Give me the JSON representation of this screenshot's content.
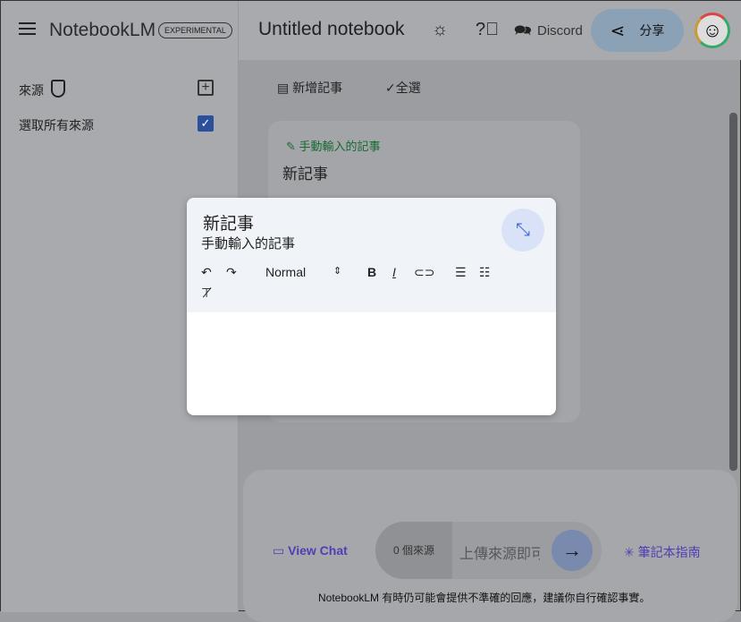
{
  "header": {
    "brand": "NotebookLM",
    "badge": "EXPERIMENTAL",
    "title": "Untitled notebook",
    "discord": "Discord",
    "share": "分享"
  },
  "sidebar": {
    "sources_label": "來源",
    "select_all": "選取所有來源"
  },
  "toolbar": {
    "add_note": "新增記事",
    "select_all": "全選"
  },
  "note_card": {
    "label": "手動輸入的記事",
    "title": "新記事"
  },
  "editor": {
    "title": "新記事",
    "subtitle": "手動輸入的記事",
    "format": "Normal",
    "body": ""
  },
  "chat": {
    "view_chat": "View Chat",
    "source_count": "0 個來源",
    "input_placeholder": "上傳來源即可開始",
    "guide": "筆記本指南",
    "disclaimer": "NotebookLM 有時仍可能會提供不準確的回應，建議你自行確認事實。"
  },
  "colors": {
    "accent": "#4e3fb4",
    "note_label": "#166a2f",
    "collapse": "#3b6bd6"
  }
}
